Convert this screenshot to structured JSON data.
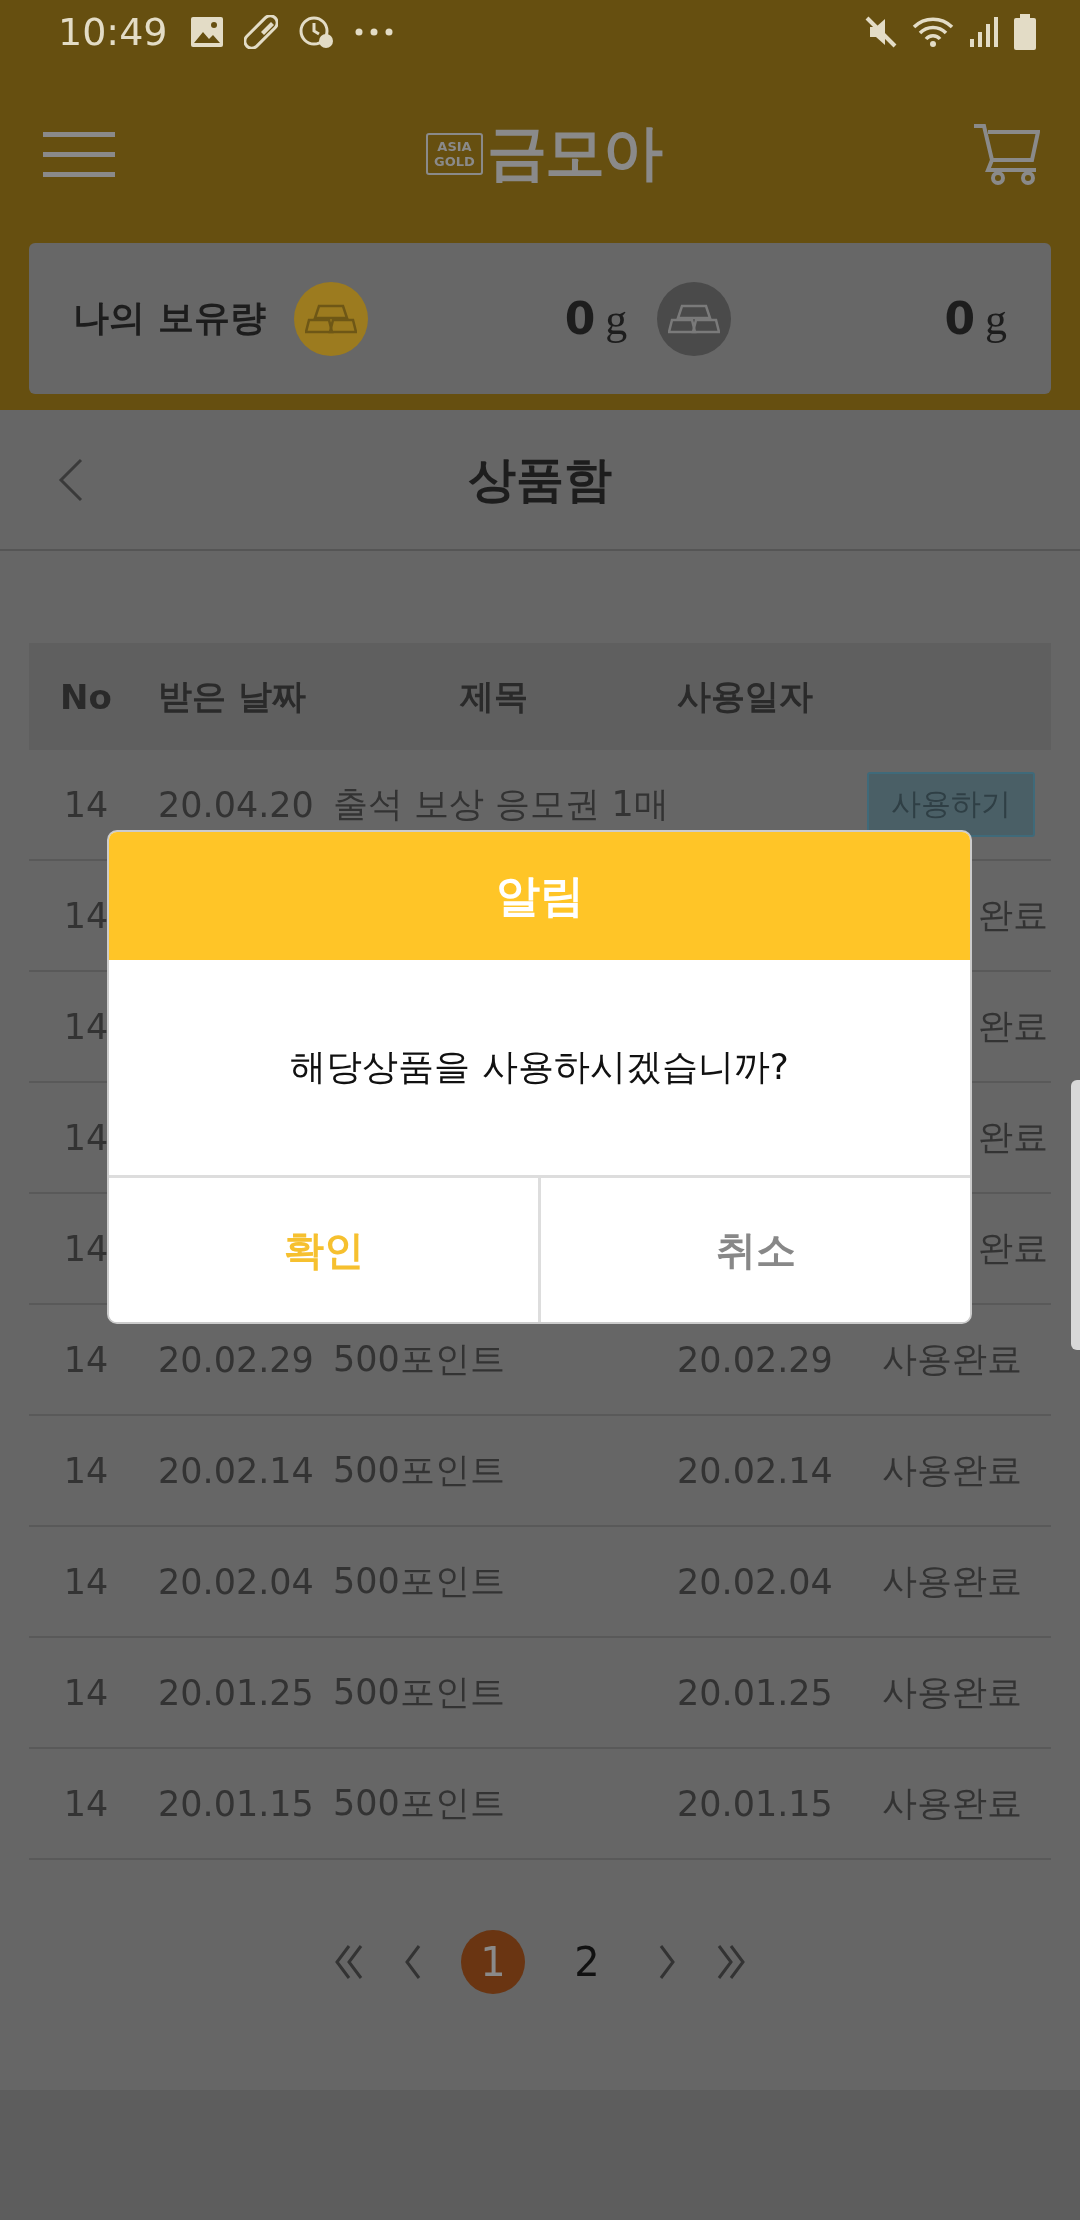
{
  "status_bar": {
    "time": "10:49"
  },
  "header": {
    "logo_badge": [
      "ASIA",
      "GOLD"
    ],
    "logo_text": "금모아"
  },
  "holdings": {
    "label": "나의 보유량",
    "balances": [
      {
        "kind": "gold",
        "amount": "0",
        "unit": "g"
      },
      {
        "kind": "silver",
        "amount": "0",
        "unit": "g"
      }
    ]
  },
  "page_title": "상품함",
  "table": {
    "columns": [
      "No",
      "받은 날짜",
      "제목",
      "사용일자"
    ],
    "rows": [
      {
        "no": "14",
        "received": "20.04.20",
        "title": "출석 보상 응모권 1매",
        "status": "사용하기",
        "kind": "button"
      },
      {
        "no": "14",
        "status": "완료",
        "kind": "cut"
      },
      {
        "no": "14",
        "status": "완료",
        "kind": "cut"
      },
      {
        "no": "14",
        "status": "완료",
        "kind": "cut"
      },
      {
        "no": "14",
        "status": "완료",
        "kind": "cut"
      },
      {
        "no": "14",
        "received": "20.02.29",
        "title": "500포인트",
        "used": "20.02.29",
        "status": "사용완료",
        "kind": "text"
      },
      {
        "no": "14",
        "received": "20.02.14",
        "title": "500포인트",
        "used": "20.02.14",
        "status": "사용완료",
        "kind": "text"
      },
      {
        "no": "14",
        "received": "20.02.04",
        "title": "500포인트",
        "used": "20.02.04",
        "status": "사용완료",
        "kind": "text"
      },
      {
        "no": "14",
        "received": "20.01.25",
        "title": "500포인트",
        "used": "20.01.25",
        "status": "사용완료",
        "kind": "text"
      },
      {
        "no": "14",
        "received": "20.01.15",
        "title": "500포인트",
        "used": "20.01.15",
        "status": "사용완료",
        "kind": "text"
      }
    ]
  },
  "pagination": {
    "pages": [
      {
        "label": "1",
        "selected": true
      },
      {
        "label": "2",
        "selected": false
      }
    ]
  },
  "dialog": {
    "title": "알림",
    "message": "해당상품을 사용하시겠습니까?",
    "buttons": [
      {
        "label": "확인",
        "kind": "confirm"
      },
      {
        "label": "취소",
        "kind": "cancel"
      }
    ]
  }
}
